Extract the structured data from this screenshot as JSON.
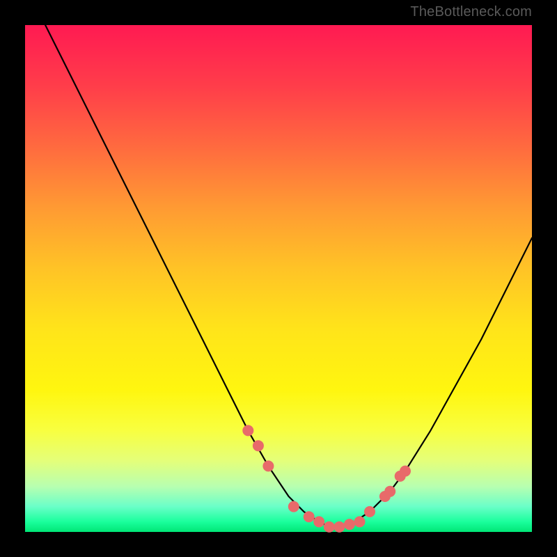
{
  "watermark": "TheBottleneck.com",
  "chart_data": {
    "type": "line",
    "title": "",
    "xlabel": "",
    "ylabel": "",
    "xlim": [
      0,
      100
    ],
    "ylim": [
      0,
      100
    ],
    "series": [
      {
        "name": "bottleneck-curve",
        "x": [
          4,
          10,
          15,
          20,
          25,
          30,
          35,
          40,
          44,
          48,
          52,
          55,
          58,
          60,
          62,
          65,
          68,
          72,
          75,
          80,
          85,
          90,
          95,
          100
        ],
        "y": [
          100,
          88,
          78,
          68,
          58,
          48,
          38,
          28,
          20,
          13,
          7,
          4,
          2,
          1,
          1,
          2,
          4,
          8,
          12,
          20,
          29,
          38,
          48,
          58
        ]
      }
    ],
    "markers": {
      "name": "highlight-dots",
      "color": "#e86a6a",
      "radius_px": 8,
      "x": [
        44,
        46,
        48,
        53,
        56,
        58,
        60,
        62,
        64,
        66,
        68,
        71,
        72,
        74,
        75
      ],
      "y": [
        20,
        17,
        13,
        5,
        3,
        2,
        1,
        1,
        1.5,
        2,
        4,
        7,
        8,
        11,
        12
      ]
    }
  }
}
